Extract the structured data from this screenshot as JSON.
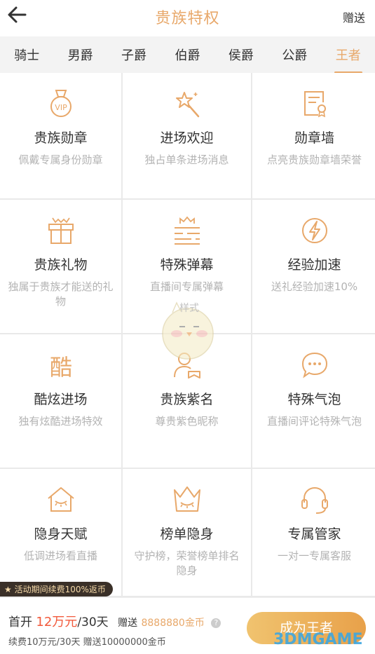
{
  "header": {
    "title": "贵族特权",
    "gift_label": "赠送",
    "back_icon": "back-arrow-icon"
  },
  "tabs": [
    {
      "label": "骑士"
    },
    {
      "label": "男爵"
    },
    {
      "label": "子爵"
    },
    {
      "label": "伯爵"
    },
    {
      "label": "侯爵"
    },
    {
      "label": "公爵"
    },
    {
      "label": "王者",
      "active": true
    }
  ],
  "privileges": [
    {
      "name": "贵族勋章",
      "desc": "佩戴专属身份勋章",
      "icon": "vip-medal-icon"
    },
    {
      "name": "进场欢迎",
      "desc": "独占单条进场消息",
      "icon": "magic-wand-star-icon"
    },
    {
      "name": "勋章墙",
      "desc": "点亮贵族勋章墙荣誉",
      "icon": "certificate-icon"
    },
    {
      "name": "贵族礼物",
      "desc": "独属于贵族才能送的礼物",
      "icon": "gift-box-icon"
    },
    {
      "name": "特殊弹幕",
      "desc": "直播间专属弹幕",
      "icon": "crown-lines-icon"
    },
    {
      "name": "经验加速",
      "desc": "送礼经验加速10%",
      "icon": "lightning-icon"
    },
    {
      "name": "酷炫进场",
      "desc": "独有炫酷进场特效",
      "icon": "cool-text-icon"
    },
    {
      "name": "贵族紫名",
      "desc": "尊贵紫色昵称",
      "icon": "user-badge-icon"
    },
    {
      "name": "特殊气泡",
      "desc": "直播间评论特殊气泡",
      "icon": "chat-bubble-icon"
    },
    {
      "name": "隐身天赋",
      "desc": "低调进场看直播",
      "icon": "house-eye-icon"
    },
    {
      "name": "榜单隐身",
      "desc": "守护榜，荣誉榜单排名隐身",
      "icon": "crown-eye-icon"
    },
    {
      "name": "专属管家",
      "desc": "一对一专属客服",
      "icon": "headset-icon"
    }
  ],
  "watermark_text": "样式",
  "promo": {
    "text": "活动期间续费100%返币"
  },
  "purchase": {
    "label_open": "首开",
    "price": "12万元",
    "period": "/30天",
    "gift_label": "赠送",
    "coins": "8888880金币",
    "help_icon": "question-icon",
    "renew": "续费10万元/30天 赠送10000000金币",
    "cta": "成为王者"
  },
  "site_watermark": "3DMGAME",
  "colors": {
    "accent": "#e8a86a",
    "price": "#f25a3c"
  }
}
